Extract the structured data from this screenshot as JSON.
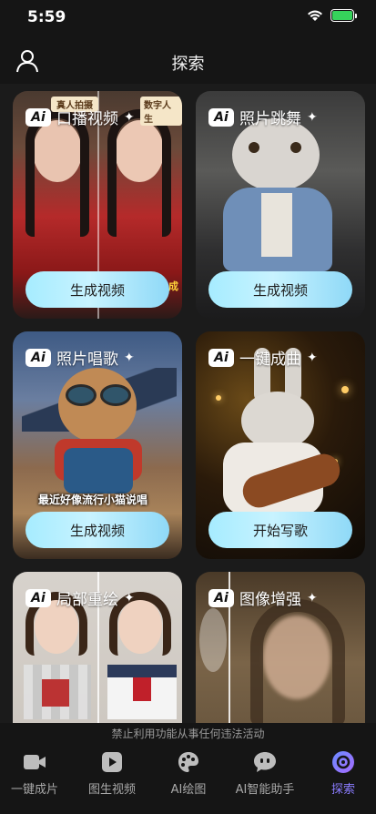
{
  "status": {
    "time": "5:59"
  },
  "header": {
    "title": "探索"
  },
  "cards": [
    {
      "label": "口播视频",
      "cta": "生成视频",
      "overlay_left": "真人拍摄",
      "overlay_right": "数字人生",
      "overlay_bottom": "生成"
    },
    {
      "label": "照片跳舞",
      "cta": "生成视频"
    },
    {
      "label": "照片唱歌",
      "cta": "生成视频",
      "caption": "最近好像流行小猫说唱"
    },
    {
      "label": "一键成曲",
      "cta": "开始写歌"
    },
    {
      "label": "局部重绘"
    },
    {
      "label": "图像增强"
    }
  ],
  "notice": "禁止利用功能从事任何违法活动",
  "tabs": [
    {
      "label": "一键成片",
      "icon": "video-camera-icon"
    },
    {
      "label": "图生视频",
      "icon": "play-video-icon"
    },
    {
      "label": "AI绘图",
      "icon": "palette-icon"
    },
    {
      "label": "AI智能助手",
      "icon": "chat-bubble-icon"
    },
    {
      "label": "探索",
      "icon": "explore-icon",
      "active": true
    }
  ],
  "colors": {
    "accent": "#8b7cff",
    "cta_start": "#a6ecff",
    "cta_end": "#8fd9f7"
  }
}
